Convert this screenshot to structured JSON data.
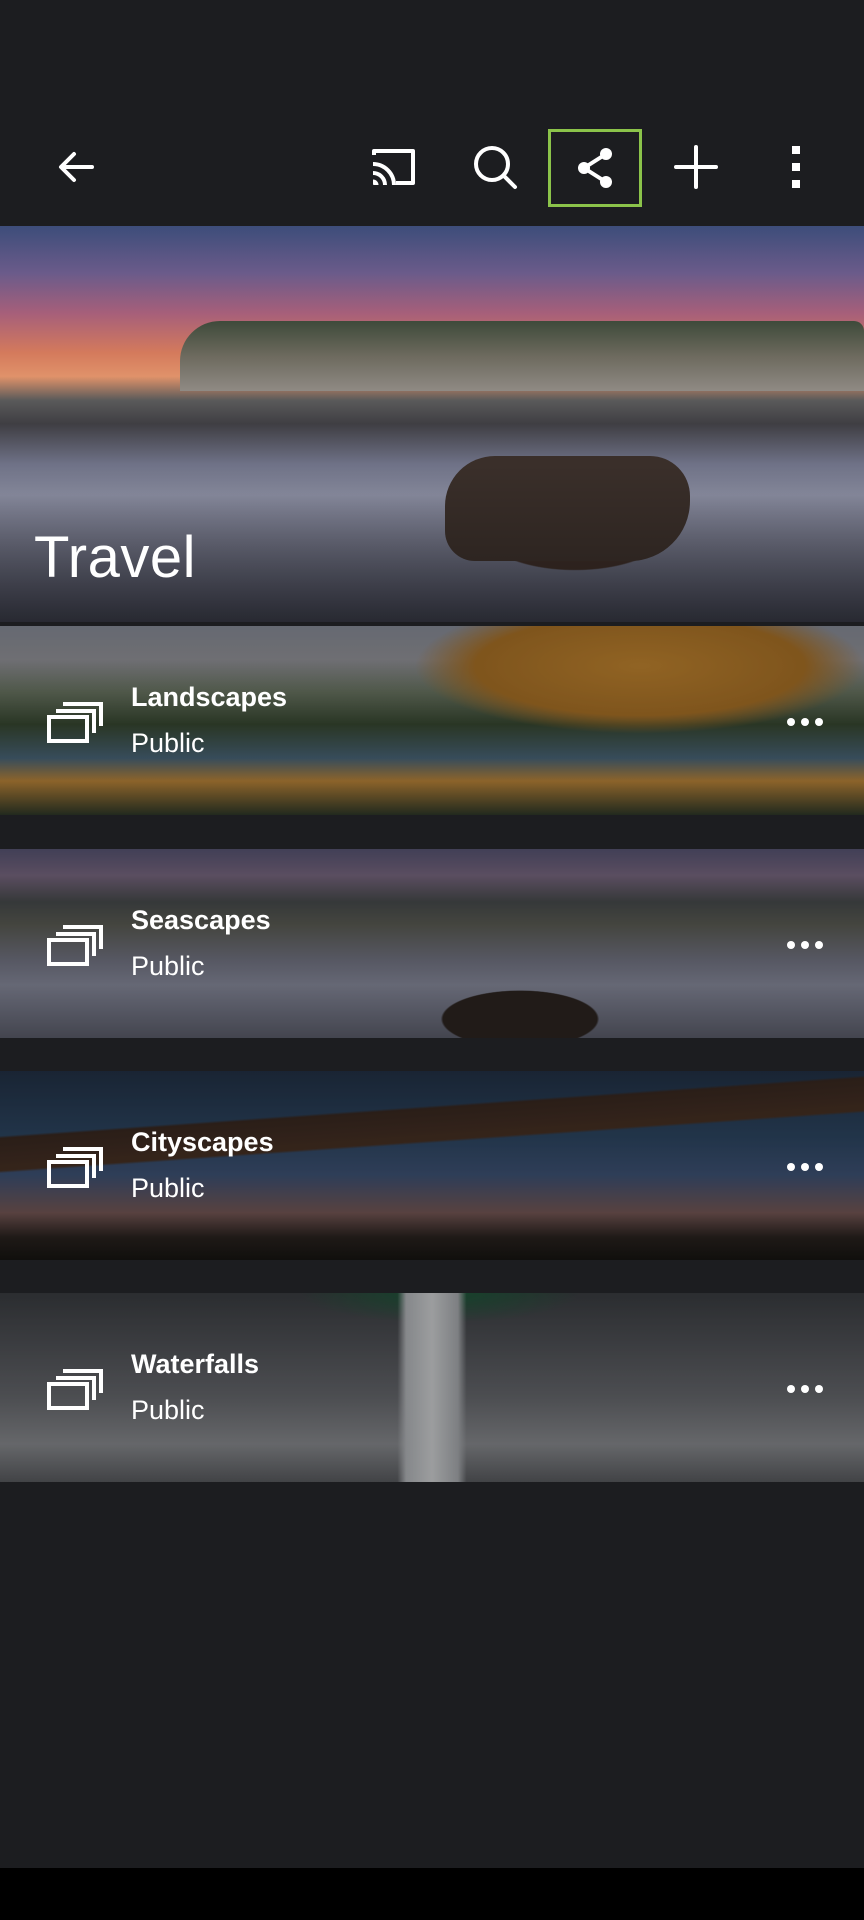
{
  "toolbar": {
    "back_icon": "arrow-left-icon",
    "cast_icon": "cast-icon",
    "search_icon": "search-icon",
    "share_icon": "share-icon",
    "add_icon": "plus-icon",
    "more_icon": "more-vertical-icon",
    "share_highlight_color": "#8bc34a"
  },
  "gallery": {
    "title": "Travel"
  },
  "albums": [
    {
      "name": "Landscapes",
      "status": "Public"
    },
    {
      "name": "Seascapes",
      "status": "Public"
    },
    {
      "name": "Cityscapes",
      "status": "Public"
    },
    {
      "name": "Waterfalls",
      "status": "Public"
    }
  ],
  "colors": {
    "background": "#1c1d20",
    "text": "#ffffff"
  }
}
